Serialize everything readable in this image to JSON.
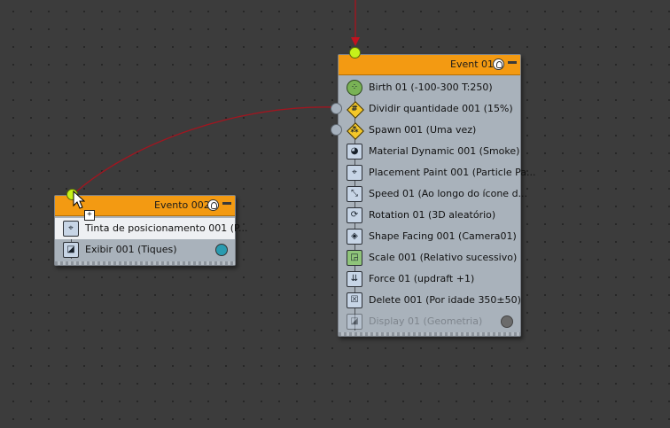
{
  "event_02": {
    "title": "Evento 002",
    "operators": [
      {
        "label": "Tinta de posicionamento 001 (P...",
        "icon": "placement-paint-icon",
        "selected": true
      },
      {
        "label": "Exibir 001 (Tiques)",
        "icon": "display-icon",
        "display_color": "#2a9bb0"
      }
    ]
  },
  "event_01": {
    "title": "Event 01",
    "operators": [
      {
        "label": "Birth 01 (-100-300 T:250)",
        "icon": "birth-icon"
      },
      {
        "label": "Dividir quantidade 001 (15%)",
        "icon": "split-amount-icon"
      },
      {
        "label": "Spawn 001 (Uma vez)",
        "icon": "spawn-icon"
      },
      {
        "label": "Material Dynamic 001 (Smoke)",
        "icon": "material-dynamic-icon"
      },
      {
        "label": "Placement Paint 001 (Particle Pa...",
        "icon": "placement-paint-icon"
      },
      {
        "label": "Speed 01 (Ao longo do ícone d...",
        "icon": "speed-icon"
      },
      {
        "label": "Rotation 01 (3D aleatório)",
        "icon": "rotation-icon"
      },
      {
        "label": "Shape Facing 001 (Camera01)",
        "icon": "shape-facing-icon"
      },
      {
        "label": "Scale 001 (Relativo sucessivo)",
        "icon": "scale-icon"
      },
      {
        "label": "Force 01 (updraft +1)",
        "icon": "force-icon"
      },
      {
        "label": "Delete 001 (Por idade 350±50)",
        "icon": "delete-icon"
      },
      {
        "label": "Display 01 (Geometria)",
        "icon": "display-icon",
        "disabled": true,
        "display_color": "#6b6b6b"
      }
    ]
  },
  "colors": {
    "canvas": "#3c3c3c",
    "node_header": "#f39a12",
    "node_body": "#a9b2bb",
    "wire": "#a01620",
    "input_port": "#c6f21a"
  }
}
